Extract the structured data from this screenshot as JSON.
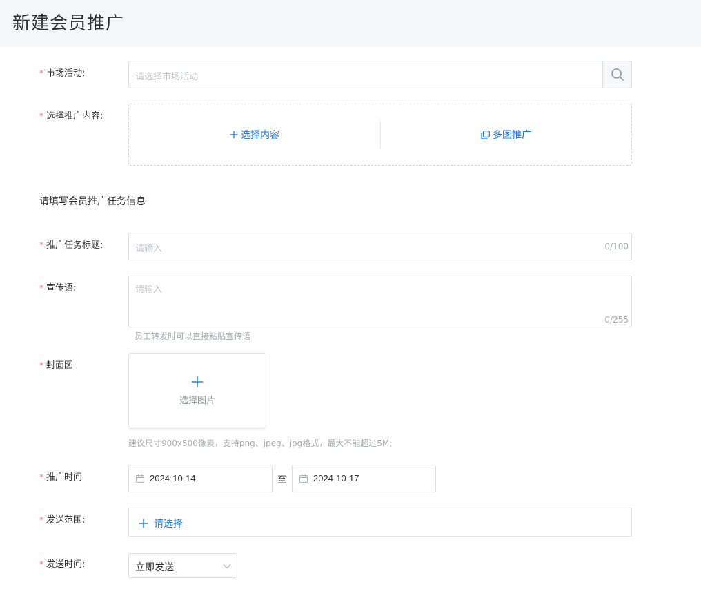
{
  "header": {
    "title": "新建会员推广"
  },
  "form": {
    "required_mark": "*",
    "market": {
      "label": "市场活动:",
      "placeholder": "请选择市场活动",
      "search_icon": "search-icon"
    },
    "content": {
      "label": "选择推广内容:",
      "select_content": "选择内容",
      "multi_image": "多图推广",
      "plus_icon": "plus-icon",
      "copy_icon": "copy-icon"
    },
    "section_title": "请填写会员推广任务信息",
    "task_title": {
      "label": "推广任务标题:",
      "placeholder": "请输入",
      "counter": "0/100"
    },
    "slogan": {
      "label": "宣传语:",
      "placeholder": "请输入",
      "counter": "0/255",
      "hint": "员工转发时可以直接粘贴宣传语"
    },
    "cover": {
      "label": "封面图",
      "upload_text": "选择图片",
      "hint": "建议尺寸900x500像素，支持png、jpeg、jpg格式，最大不能超过5M;"
    },
    "period": {
      "label": "推广时间",
      "start": "2024-10-14",
      "separator": "至",
      "end": "2024-10-17",
      "calendar_icon": "calendar-icon"
    },
    "scope": {
      "label": "发送范围:",
      "action": "请选择"
    },
    "send_time": {
      "label": "发送时间:",
      "value": "立即发送",
      "arrow_icon": "chevron-down-icon"
    }
  },
  "colors": {
    "accent": "#1677ff",
    "required": "#f56c6c",
    "placeholder": "#c0c4cc",
    "header_bg": "#f5f6f8"
  }
}
